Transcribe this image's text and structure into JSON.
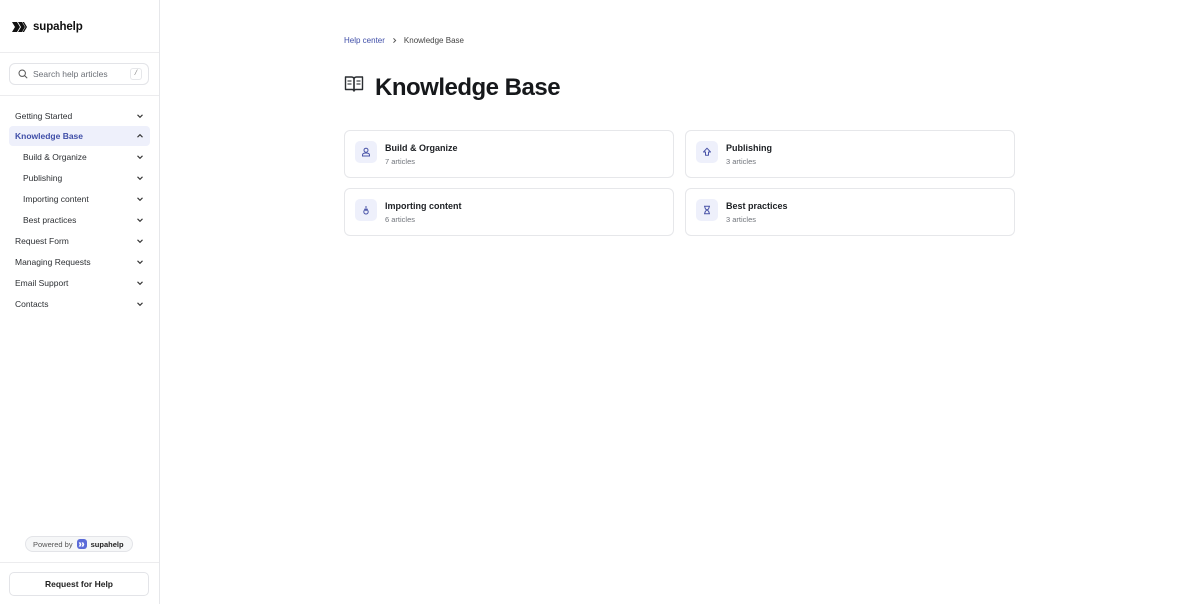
{
  "brand": {
    "name": "supahelp",
    "logo_icon": "supahelp-logo-icon"
  },
  "search": {
    "placeholder": "Search help articles",
    "shortcut": "/"
  },
  "sidebar": {
    "items": [
      {
        "label": "Getting Started",
        "level": 1,
        "active": false,
        "expanded": false
      },
      {
        "label": "Knowledge Base",
        "level": 1,
        "active": true,
        "expanded": true
      },
      {
        "label": "Build & Organize",
        "level": 2,
        "active": false,
        "expanded": false
      },
      {
        "label": "Publishing",
        "level": 2,
        "active": false,
        "expanded": false
      },
      {
        "label": "Importing content",
        "level": 2,
        "active": false,
        "expanded": false
      },
      {
        "label": "Best practices",
        "level": 2,
        "active": false,
        "expanded": false
      },
      {
        "label": "Request Form",
        "level": 1,
        "active": false,
        "expanded": false
      },
      {
        "label": "Managing Requests",
        "level": 1,
        "active": false,
        "expanded": false
      },
      {
        "label": "Email Support",
        "level": 1,
        "active": false,
        "expanded": false
      },
      {
        "label": "Contacts",
        "level": 1,
        "active": false,
        "expanded": false
      }
    ],
    "powered_by": {
      "prefix": "Powered by",
      "brand": "supahelp"
    },
    "help_button": "Request for Help"
  },
  "breadcrumb": {
    "parent": "Help center",
    "current": "Knowledge Base"
  },
  "page": {
    "title": "Knowledge Base",
    "icon": "book-open-icon"
  },
  "categories": [
    {
      "title": "Build & Organize",
      "count": "7 articles",
      "icon": "person-icon"
    },
    {
      "title": "Publishing",
      "count": "3 articles",
      "icon": "upload-arrow-icon"
    },
    {
      "title": "Importing content",
      "count": "6 articles",
      "icon": "import-icon"
    },
    {
      "title": "Best practices",
      "count": "3 articles",
      "icon": "hourglass-icon"
    }
  ],
  "colors": {
    "accent": "#3f4ea8",
    "active_bg": "#eef0fb",
    "border": "#e6e7ea"
  }
}
